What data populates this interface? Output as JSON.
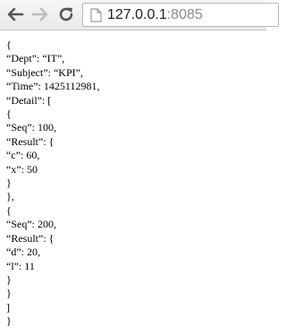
{
  "toolbar": {
    "back_icon": "back-arrow-icon",
    "forward_icon": "forward-arrow-icon",
    "reload_icon": "reload-icon",
    "url_host": "127.0.0.1",
    "url_port": ":8085"
  },
  "content": {
    "lines": [
      "{",
      "“Dept”: “IT”,",
      "“Subject”: “KPI”,",
      "“Time”: 1425112981,",
      "“Detail”: [",
      "{",
      "“Seq”: 100,",
      "“Result”: {",
      "“c”: 60,",
      "“x”: 50",
      "}",
      "},",
      "{",
      "“Seq”: 200,",
      "“Result”: {",
      "“d”: 20,",
      "“l”: 11",
      "}",
      "}",
      "]",
      "}"
    ]
  }
}
